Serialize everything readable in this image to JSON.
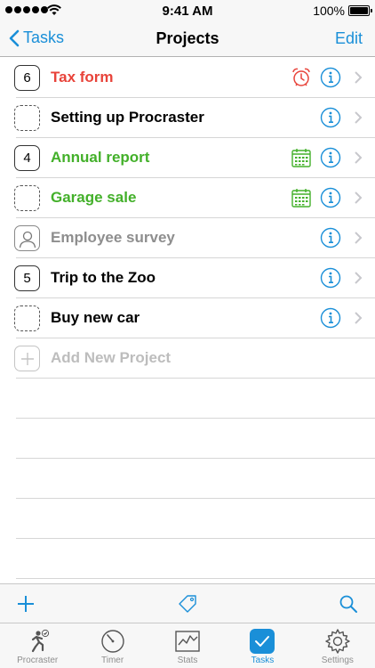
{
  "status_bar": {
    "time": "9:41 AM",
    "battery": "100%"
  },
  "nav": {
    "back_label": "Tasks",
    "title": "Projects",
    "edit_label": "Edit"
  },
  "projects": [
    {
      "count": "6",
      "title": "Tax form",
      "color": "#e8433a",
      "icon": "alarm-clock-icon",
      "box": "count"
    },
    {
      "count": "",
      "title": "Setting up Procraster",
      "color": "#000000",
      "icon": "",
      "box": "dashed"
    },
    {
      "count": "4",
      "title": "Annual report",
      "color": "#43b02a",
      "icon": "calendar-icon",
      "box": "count"
    },
    {
      "count": "",
      "title": "Garage sale",
      "color": "#43b02a",
      "icon": "calendar-icon",
      "box": "dashed"
    },
    {
      "count": "",
      "title": "Employee survey",
      "color": "#8e8e8e",
      "icon": "",
      "box": "person"
    },
    {
      "count": "5",
      "title": "Trip to the Zoo",
      "color": "#000000",
      "icon": "",
      "box": "count"
    },
    {
      "count": "",
      "title": "Buy new car",
      "color": "#000000",
      "icon": "",
      "box": "dashed"
    }
  ],
  "add_project": {
    "placeholder": "Add New Project"
  },
  "toolbar": {
    "add_icon": "plus-icon",
    "tag_icon": "tag-icon",
    "search_icon": "search-icon"
  },
  "tabs": [
    {
      "label": "Procraster",
      "icon": "runner-icon"
    },
    {
      "label": "Timer",
      "icon": "timer-icon"
    },
    {
      "label": "Stats",
      "icon": "stats-icon"
    },
    {
      "label": "Tasks",
      "icon": "checkmark-icon",
      "active": true
    },
    {
      "label": "Settings",
      "icon": "gear-icon"
    }
  ],
  "colors": {
    "accent": "#1a8fd8",
    "red": "#e8433a",
    "green": "#43b02a",
    "gray": "#8e8e8e"
  }
}
